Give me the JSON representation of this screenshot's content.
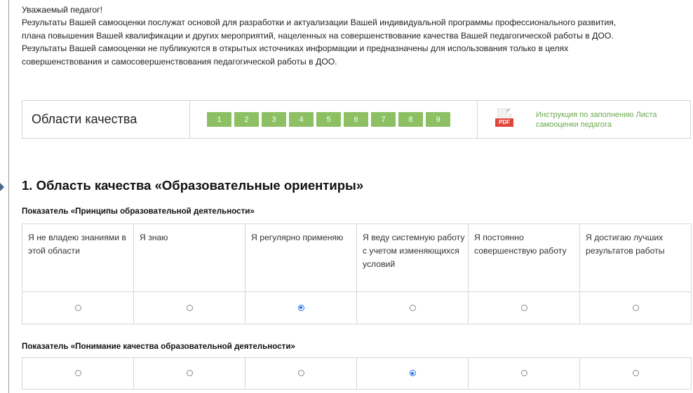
{
  "intro": {
    "lines": [
      "Уважаемый педагог!",
      "Результаты Вашей самооценки послужат основой для разработки и актуализации Вашей индивидуальной программы профессионального развития,",
      "плана повышения Вашей квалификации и других мероприятий, нацеленных на совершенствование качества Вашей педагогической работы в ДОО.",
      "Результаты Вашей самооценки не публикуются в открытых источниках информации и предназначены для использования только в целях",
      "совершенствования и самосовершенствования педагогической работы в ДОО."
    ]
  },
  "quality_areas": {
    "title": "Области качества",
    "buttons": [
      "1",
      "2",
      "3",
      "4",
      "5",
      "6",
      "7",
      "8",
      "9"
    ],
    "button_color": "#8cc063",
    "pdf_icon": {
      "icon": "pdf-file-icon",
      "label": "PDF"
    },
    "instruction_link_lines": [
      "Инструкция по заполнению Листа",
      "самооценки педагога"
    ]
  },
  "section": {
    "title": "1. Область качества «Образовательные ориентиры»"
  },
  "indicators": [
    {
      "title": "Показатель «Принципы образовательной деятельности»",
      "options": [
        "Я не владею знаниями в этой области",
        "Я знаю",
        "Я регулярно применяю",
        "Я веду системную работу с учетом изменяющихся условий",
        "Я постоянно совершенствую работу",
        "Я достигаю лучших результатов работы"
      ],
      "selected_index": 2
    },
    {
      "title": "Показатель «Понимание качества образовательной деятельности»",
      "selected_index": 3
    }
  ],
  "colors": {
    "accent_green": "#8cc063",
    "link_green": "#6aa84f",
    "radio_selected": "#1a73e8",
    "pdf_red": "#e0443a"
  }
}
